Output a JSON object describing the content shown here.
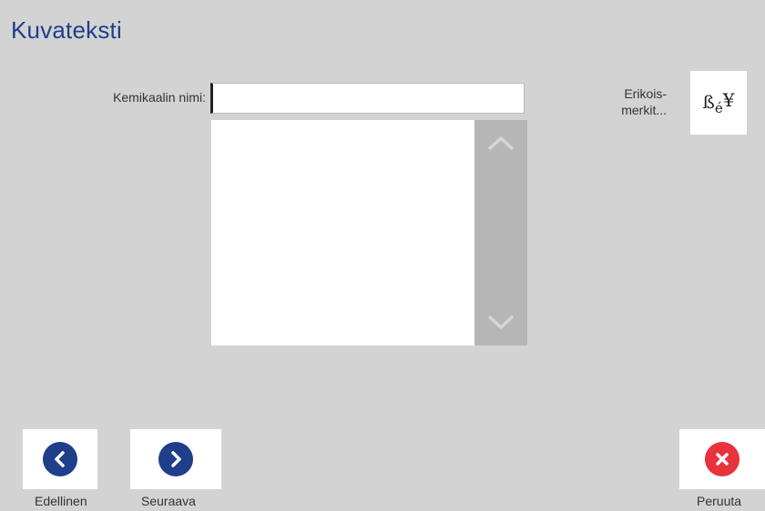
{
  "page": {
    "title": "Kuvateksti"
  },
  "form": {
    "chemical_name_label": "Kemikaalin nimi:",
    "chemical_name_value": ""
  },
  "special_chars": {
    "label_line1": "Erikois-",
    "label_line2": "merkit...",
    "glyph_main": "ß",
    "glyph_sub": "é",
    "glyph_yen": "¥"
  },
  "footer": {
    "previous_label": "Edellinen",
    "next_label": "Seuraava",
    "cancel_label": "Peruuta"
  },
  "icons": {
    "previous": "chevron-left-icon",
    "next": "chevron-right-icon",
    "cancel": "close-icon",
    "scroll_up": "chevron-up-icon",
    "scroll_down": "chevron-down-icon"
  },
  "colors": {
    "background": "#d3d3d3",
    "title": "#1f3f8a",
    "nav_circle": "#1f3f8a",
    "cancel_circle": "#e8323c",
    "scrollbar": "#b6b6b6"
  }
}
